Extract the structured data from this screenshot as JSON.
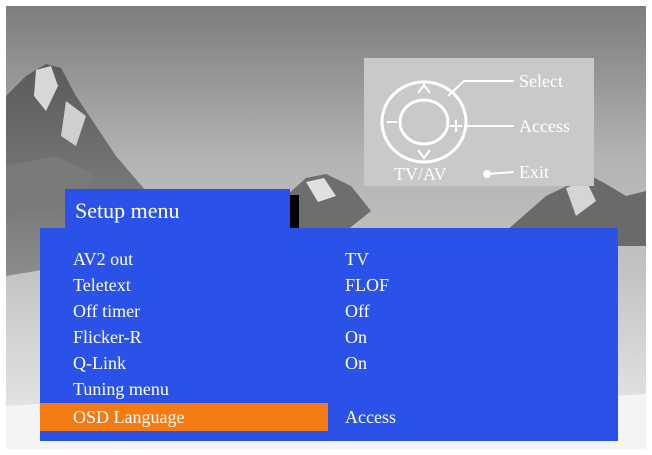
{
  "guide": {
    "select": "Select",
    "access": "Access",
    "exit": "Exit",
    "tvav": "TV/AV"
  },
  "menu": {
    "title": "Setup menu",
    "items": [
      {
        "label": "AV2 out",
        "value": "TV"
      },
      {
        "label": "Teletext",
        "value": "FLOF"
      },
      {
        "label": "Off timer",
        "value": "Off"
      },
      {
        "label": "Flicker-R",
        "value": "On"
      },
      {
        "label": "Q-Link",
        "value": "On"
      },
      {
        "label": "Tuning menu",
        "value": ""
      },
      {
        "label": "OSD Language",
        "value": "Access",
        "selected": true
      }
    ]
  },
  "colors": {
    "menu_blue": "#2a52e8",
    "highlight_orange": "#f47a14",
    "guide_gray": "#c9c9c9"
  },
  "icons": [
    "dpad-icon",
    "up-arrow-icon",
    "down-arrow-icon",
    "minus-icon",
    "plus-icon",
    "exit-dot-icon"
  ]
}
